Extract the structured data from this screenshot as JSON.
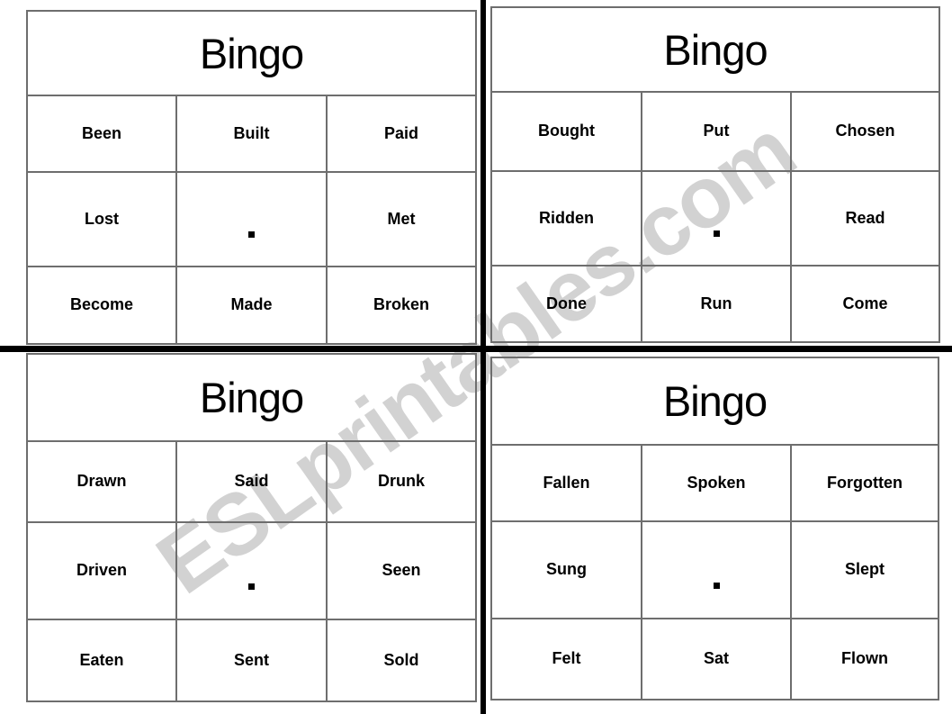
{
  "watermark": {
    "text": "ESLprintables.com",
    "color": "#d2d2d2"
  },
  "colors": {
    "cell_border": "#6e6e6e",
    "cut_line": "#000000",
    "text": "#000000",
    "background": "#ffffff"
  },
  "cards": [
    {
      "id": "card-1",
      "title": "Bingo",
      "rows": [
        [
          {
            "label": "Been",
            "free": false
          },
          {
            "label": "Built",
            "free": false
          },
          {
            "label": "Paid",
            "free": false
          }
        ],
        [
          {
            "label": "Lost",
            "free": false
          },
          {
            "label": "",
            "free": true
          },
          {
            "label": "Met",
            "free": false
          }
        ],
        [
          {
            "label": "Become",
            "free": false
          },
          {
            "label": "Made",
            "free": false
          },
          {
            "label": "Broken",
            "free": false
          }
        ]
      ]
    },
    {
      "id": "card-2",
      "title": "Bingo",
      "rows": [
        [
          {
            "label": "Bought",
            "free": false
          },
          {
            "label": "Put",
            "free": false
          },
          {
            "label": "Chosen",
            "free": false
          }
        ],
        [
          {
            "label": "Ridden",
            "free": false
          },
          {
            "label": "",
            "free": true
          },
          {
            "label": "Read",
            "free": false
          }
        ],
        [
          {
            "label": "Done",
            "free": false
          },
          {
            "label": "Run",
            "free": false
          },
          {
            "label": "Come",
            "free": false
          }
        ]
      ]
    },
    {
      "id": "card-3",
      "title": "Bingo",
      "rows": [
        [
          {
            "label": "Drawn",
            "free": false
          },
          {
            "label": "Said",
            "free": false
          },
          {
            "label": "Drunk",
            "free": false
          }
        ],
        [
          {
            "label": "Driven",
            "free": false
          },
          {
            "label": "",
            "free": true
          },
          {
            "label": "Seen",
            "free": false
          }
        ],
        [
          {
            "label": "Eaten",
            "free": false
          },
          {
            "label": "Sent",
            "free": false
          },
          {
            "label": "Sold",
            "free": false
          }
        ]
      ]
    },
    {
      "id": "card-4",
      "title": "Bingo",
      "rows": [
        [
          {
            "label": "Fallen",
            "free": false
          },
          {
            "label": "Spoken",
            "free": false
          },
          {
            "label": "Forgotten",
            "free": false
          }
        ],
        [
          {
            "label": "Sung",
            "free": false
          },
          {
            "label": "",
            "free": true
          },
          {
            "label": "Slept",
            "free": false
          }
        ],
        [
          {
            "label": "Felt",
            "free": false
          },
          {
            "label": "Sat",
            "free": false
          },
          {
            "label": "Flown",
            "free": false
          }
        ]
      ]
    }
  ]
}
